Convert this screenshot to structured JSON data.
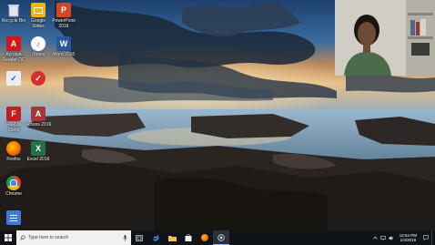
{
  "desktop": {
    "icons": [
      {
        "label": "Recycle Bin",
        "icon": "recycle-bin-icon"
      },
      {
        "label": "Google Slides",
        "icon": "google-slides-icon"
      },
      {
        "label": "PowerPoint 2016",
        "icon": "powerpoint-icon"
      },
      {
        "label": "Acrobat Reader DC",
        "icon": "acrobat-reader-icon"
      },
      {
        "label": "iTunes",
        "icon": "itunes-icon"
      },
      {
        "label": "Word 2016",
        "icon": "word-icon"
      },
      {
        "label": "",
        "icon": "shortcut-document-icon"
      },
      {
        "label": "",
        "icon": "red-check-app-icon"
      },
      {
        "label": "FileZilla Client",
        "icon": "filezilla-icon"
      },
      {
        "label": "Access 2016",
        "icon": "access-icon"
      },
      {
        "label": "Firefox",
        "icon": "firefox-icon"
      },
      {
        "label": "Excel 2016",
        "icon": "excel-icon"
      },
      {
        "label": "Chrome",
        "icon": "chrome-icon"
      },
      {
        "label": "",
        "icon": "document-file-icon"
      }
    ]
  },
  "taskbar": {
    "search_placeholder": "Type here to search",
    "apps": [
      "task-view-icon",
      "edge-icon",
      "file-explorer-icon",
      "store-icon",
      "firefox-icon",
      "screen-recorder-icon"
    ],
    "clock_time": "12:54 PM",
    "clock_date": "1/4/2019"
  },
  "colors": {
    "taskbar": "#101418",
    "sky_top": "#1d3f6e",
    "sea": "#7fa6c4",
    "rocks": "#2a2521",
    "word": "#2b579a",
    "excel": "#217346",
    "powerpoint": "#d24726",
    "access": "#a4373a",
    "acrobat": "#d7141a"
  }
}
